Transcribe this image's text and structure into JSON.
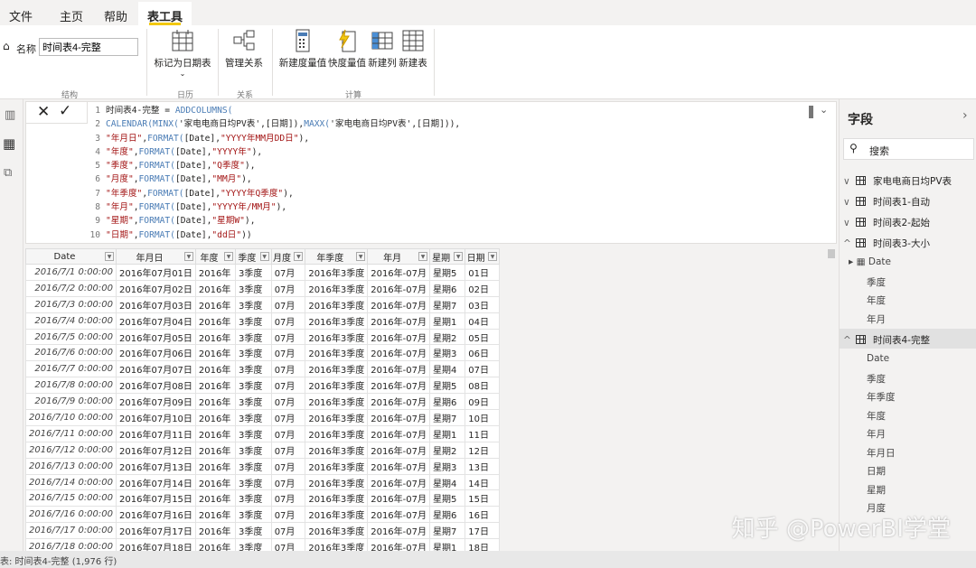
{
  "menu": {
    "file": "文件",
    "home": "主页",
    "help": "帮助",
    "table_tools": "表工具"
  },
  "ribbon": {
    "name_label": "名称",
    "name_value": "时间表4-完整",
    "mark_date_table": "标记为日期表",
    "manage_relations": "管理关系",
    "new_measure": "新建度量值",
    "quick_measure": "快度量值",
    "new_column": "新建列",
    "new_table": "新建表",
    "group_structure": "结构",
    "group_calendar": "日历",
    "group_relations": "关系",
    "group_calc": "计算"
  },
  "formula": {
    "lines": [
      [
        {
          "t": "时间表4-完整 = "
        },
        {
          "t": "ADDCOLUMNS(",
          "c": "kw"
        }
      ],
      [
        {
          "t": "CALENDAR(MINX(",
          "c": "kw"
        },
        {
          "t": "'家电电商日均PV表',[日期]),"
        },
        {
          "t": "MAXX(",
          "c": "kw"
        },
        {
          "t": "'家电电商日均PV表',[日期])),"
        }
      ],
      [
        {
          "t": "\"年月日\"",
          "c": "st"
        },
        {
          "t": ","
        },
        {
          "t": "FORMAT(",
          "c": "kw"
        },
        {
          "t": "[Date],"
        },
        {
          "t": "\"YYYY年MM月DD日\"",
          "c": "st"
        },
        {
          "t": "),"
        }
      ],
      [
        {
          "t": "\"年度\"",
          "c": "st"
        },
        {
          "t": ","
        },
        {
          "t": "FORMAT(",
          "c": "kw"
        },
        {
          "t": "[Date],"
        },
        {
          "t": "\"YYYY年\"",
          "c": "st"
        },
        {
          "t": "),"
        }
      ],
      [
        {
          "t": "\"季度\"",
          "c": "st"
        },
        {
          "t": ","
        },
        {
          "t": "FORMAT(",
          "c": "kw"
        },
        {
          "t": "[Date],"
        },
        {
          "t": "\"Q季度\"",
          "c": "st"
        },
        {
          "t": "),"
        }
      ],
      [
        {
          "t": "\"月度\"",
          "c": "st"
        },
        {
          "t": ","
        },
        {
          "t": "FORMAT(",
          "c": "kw"
        },
        {
          "t": "[Date],"
        },
        {
          "t": "\"MM月\"",
          "c": "st"
        },
        {
          "t": "),"
        }
      ],
      [
        {
          "t": "\"年季度\"",
          "c": "st"
        },
        {
          "t": ","
        },
        {
          "t": "FORMAT(",
          "c": "kw"
        },
        {
          "t": "[Date],"
        },
        {
          "t": "\"YYYY年Q季度\"",
          "c": "st"
        },
        {
          "t": "),"
        }
      ],
      [
        {
          "t": "\"年月\"",
          "c": "st"
        },
        {
          "t": ","
        },
        {
          "t": "FORMAT(",
          "c": "kw"
        },
        {
          "t": "[Date],"
        },
        {
          "t": "\"YYYY年/MM月\"",
          "c": "st"
        },
        {
          "t": "),"
        }
      ],
      [
        {
          "t": "\"星期\"",
          "c": "st"
        },
        {
          "t": ","
        },
        {
          "t": "FORMAT(",
          "c": "kw"
        },
        {
          "t": "[Date],"
        },
        {
          "t": "\"星期W\"",
          "c": "st"
        },
        {
          "t": "),"
        }
      ],
      [
        {
          "t": "\"日期\"",
          "c": "st"
        },
        {
          "t": ","
        },
        {
          "t": "FORMAT(",
          "c": "kw"
        },
        {
          "t": "[Date],"
        },
        {
          "t": "\"dd日\"",
          "c": "st"
        },
        {
          "t": "))"
        }
      ]
    ]
  },
  "table": {
    "columns": [
      "Date",
      "年月日",
      "年度",
      "季度",
      "月度",
      "年季度",
      "年月",
      "星期",
      "日期"
    ],
    "rows": [
      [
        "2016/7/1 0:00:00",
        "2016年07月01日",
        "2016年",
        "3季度",
        "07月",
        "2016年3季度",
        "2016年-07月",
        "星期5",
        "01日"
      ],
      [
        "2016/7/2 0:00:00",
        "2016年07月02日",
        "2016年",
        "3季度",
        "07月",
        "2016年3季度",
        "2016年-07月",
        "星期6",
        "02日"
      ],
      [
        "2016/7/3 0:00:00",
        "2016年07月03日",
        "2016年",
        "3季度",
        "07月",
        "2016年3季度",
        "2016年-07月",
        "星期7",
        "03日"
      ],
      [
        "2016/7/4 0:00:00",
        "2016年07月04日",
        "2016年",
        "3季度",
        "07月",
        "2016年3季度",
        "2016年-07月",
        "星期1",
        "04日"
      ],
      [
        "2016/7/5 0:00:00",
        "2016年07月05日",
        "2016年",
        "3季度",
        "07月",
        "2016年3季度",
        "2016年-07月",
        "星期2",
        "05日"
      ],
      [
        "2016/7/6 0:00:00",
        "2016年07月06日",
        "2016年",
        "3季度",
        "07月",
        "2016年3季度",
        "2016年-07月",
        "星期3",
        "06日"
      ],
      [
        "2016/7/7 0:00:00",
        "2016年07月07日",
        "2016年",
        "3季度",
        "07月",
        "2016年3季度",
        "2016年-07月",
        "星期4",
        "07日"
      ],
      [
        "2016/7/8 0:00:00",
        "2016年07月08日",
        "2016年",
        "3季度",
        "07月",
        "2016年3季度",
        "2016年-07月",
        "星期5",
        "08日"
      ],
      [
        "2016/7/9 0:00:00",
        "2016年07月09日",
        "2016年",
        "3季度",
        "07月",
        "2016年3季度",
        "2016年-07月",
        "星期6",
        "09日"
      ],
      [
        "2016/7/10 0:00:00",
        "2016年07月10日",
        "2016年",
        "3季度",
        "07月",
        "2016年3季度",
        "2016年-07月",
        "星期7",
        "10日"
      ],
      [
        "2016/7/11 0:00:00",
        "2016年07月11日",
        "2016年",
        "3季度",
        "07月",
        "2016年3季度",
        "2016年-07月",
        "星期1",
        "11日"
      ],
      [
        "2016/7/12 0:00:00",
        "2016年07月12日",
        "2016年",
        "3季度",
        "07月",
        "2016年3季度",
        "2016年-07月",
        "星期2",
        "12日"
      ],
      [
        "2016/7/13 0:00:00",
        "2016年07月13日",
        "2016年",
        "3季度",
        "07月",
        "2016年3季度",
        "2016年-07月",
        "星期3",
        "13日"
      ],
      [
        "2016/7/14 0:00:00",
        "2016年07月14日",
        "2016年",
        "3季度",
        "07月",
        "2016年3季度",
        "2016年-07月",
        "星期4",
        "14日"
      ],
      [
        "2016/7/15 0:00:00",
        "2016年07月15日",
        "2016年",
        "3季度",
        "07月",
        "2016年3季度",
        "2016年-07月",
        "星期5",
        "15日"
      ],
      [
        "2016/7/16 0:00:00",
        "2016年07月16日",
        "2016年",
        "3季度",
        "07月",
        "2016年3季度",
        "2016年-07月",
        "星期6",
        "16日"
      ],
      [
        "2016/7/17 0:00:00",
        "2016年07月17日",
        "2016年",
        "3季度",
        "07月",
        "2016年3季度",
        "2016年-07月",
        "星期7",
        "17日"
      ],
      [
        "2016/7/18 0:00:00",
        "2016年07月18日",
        "2016年",
        "3季度",
        "07月",
        "2016年3季度",
        "2016年-07月",
        "星期1",
        "18日"
      ]
    ]
  },
  "fields": {
    "title": "字段",
    "search_placeholder": "搜索",
    "tables": [
      "家电电商日均PV表",
      "时间表1-自动",
      "时间表2-起始",
      "时间表3-大小",
      "时间表4-完整"
    ],
    "table3_fields": [
      "Date",
      "季度",
      "年度",
      "年月"
    ],
    "table4_fields": [
      "Date",
      "季度",
      "年季度",
      "年度",
      "年月",
      "年月日",
      "日期",
      "星期",
      "月度"
    ]
  },
  "status": "表: 时间表4-完整 (1,976 行)",
  "watermark": "知乎 @PowerBI学堂"
}
